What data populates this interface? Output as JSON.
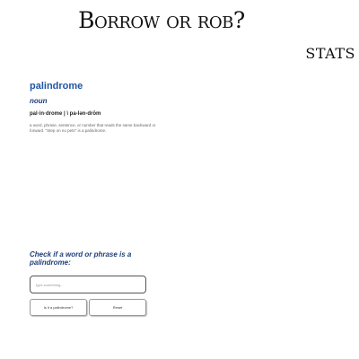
{
  "header": {
    "title": "Borrow or rob?",
    "stats_link": "STATS"
  },
  "definition": {
    "word": "palindrome",
    "part_of_speech": "noun",
    "pronunciation": "pal·in·drome | \\ pa-lən-drōm",
    "text": "a word, phrase, sentence, or number that reads the same backward or forward. \"Step on no pets\" is a palindrome."
  },
  "checker": {
    "heading": "Check if a word or phrase is a palindrome:",
    "input_value": "",
    "input_placeholder": "type something...",
    "check_button": "Is it a palindrome?",
    "reset_button": "Reset"
  }
}
